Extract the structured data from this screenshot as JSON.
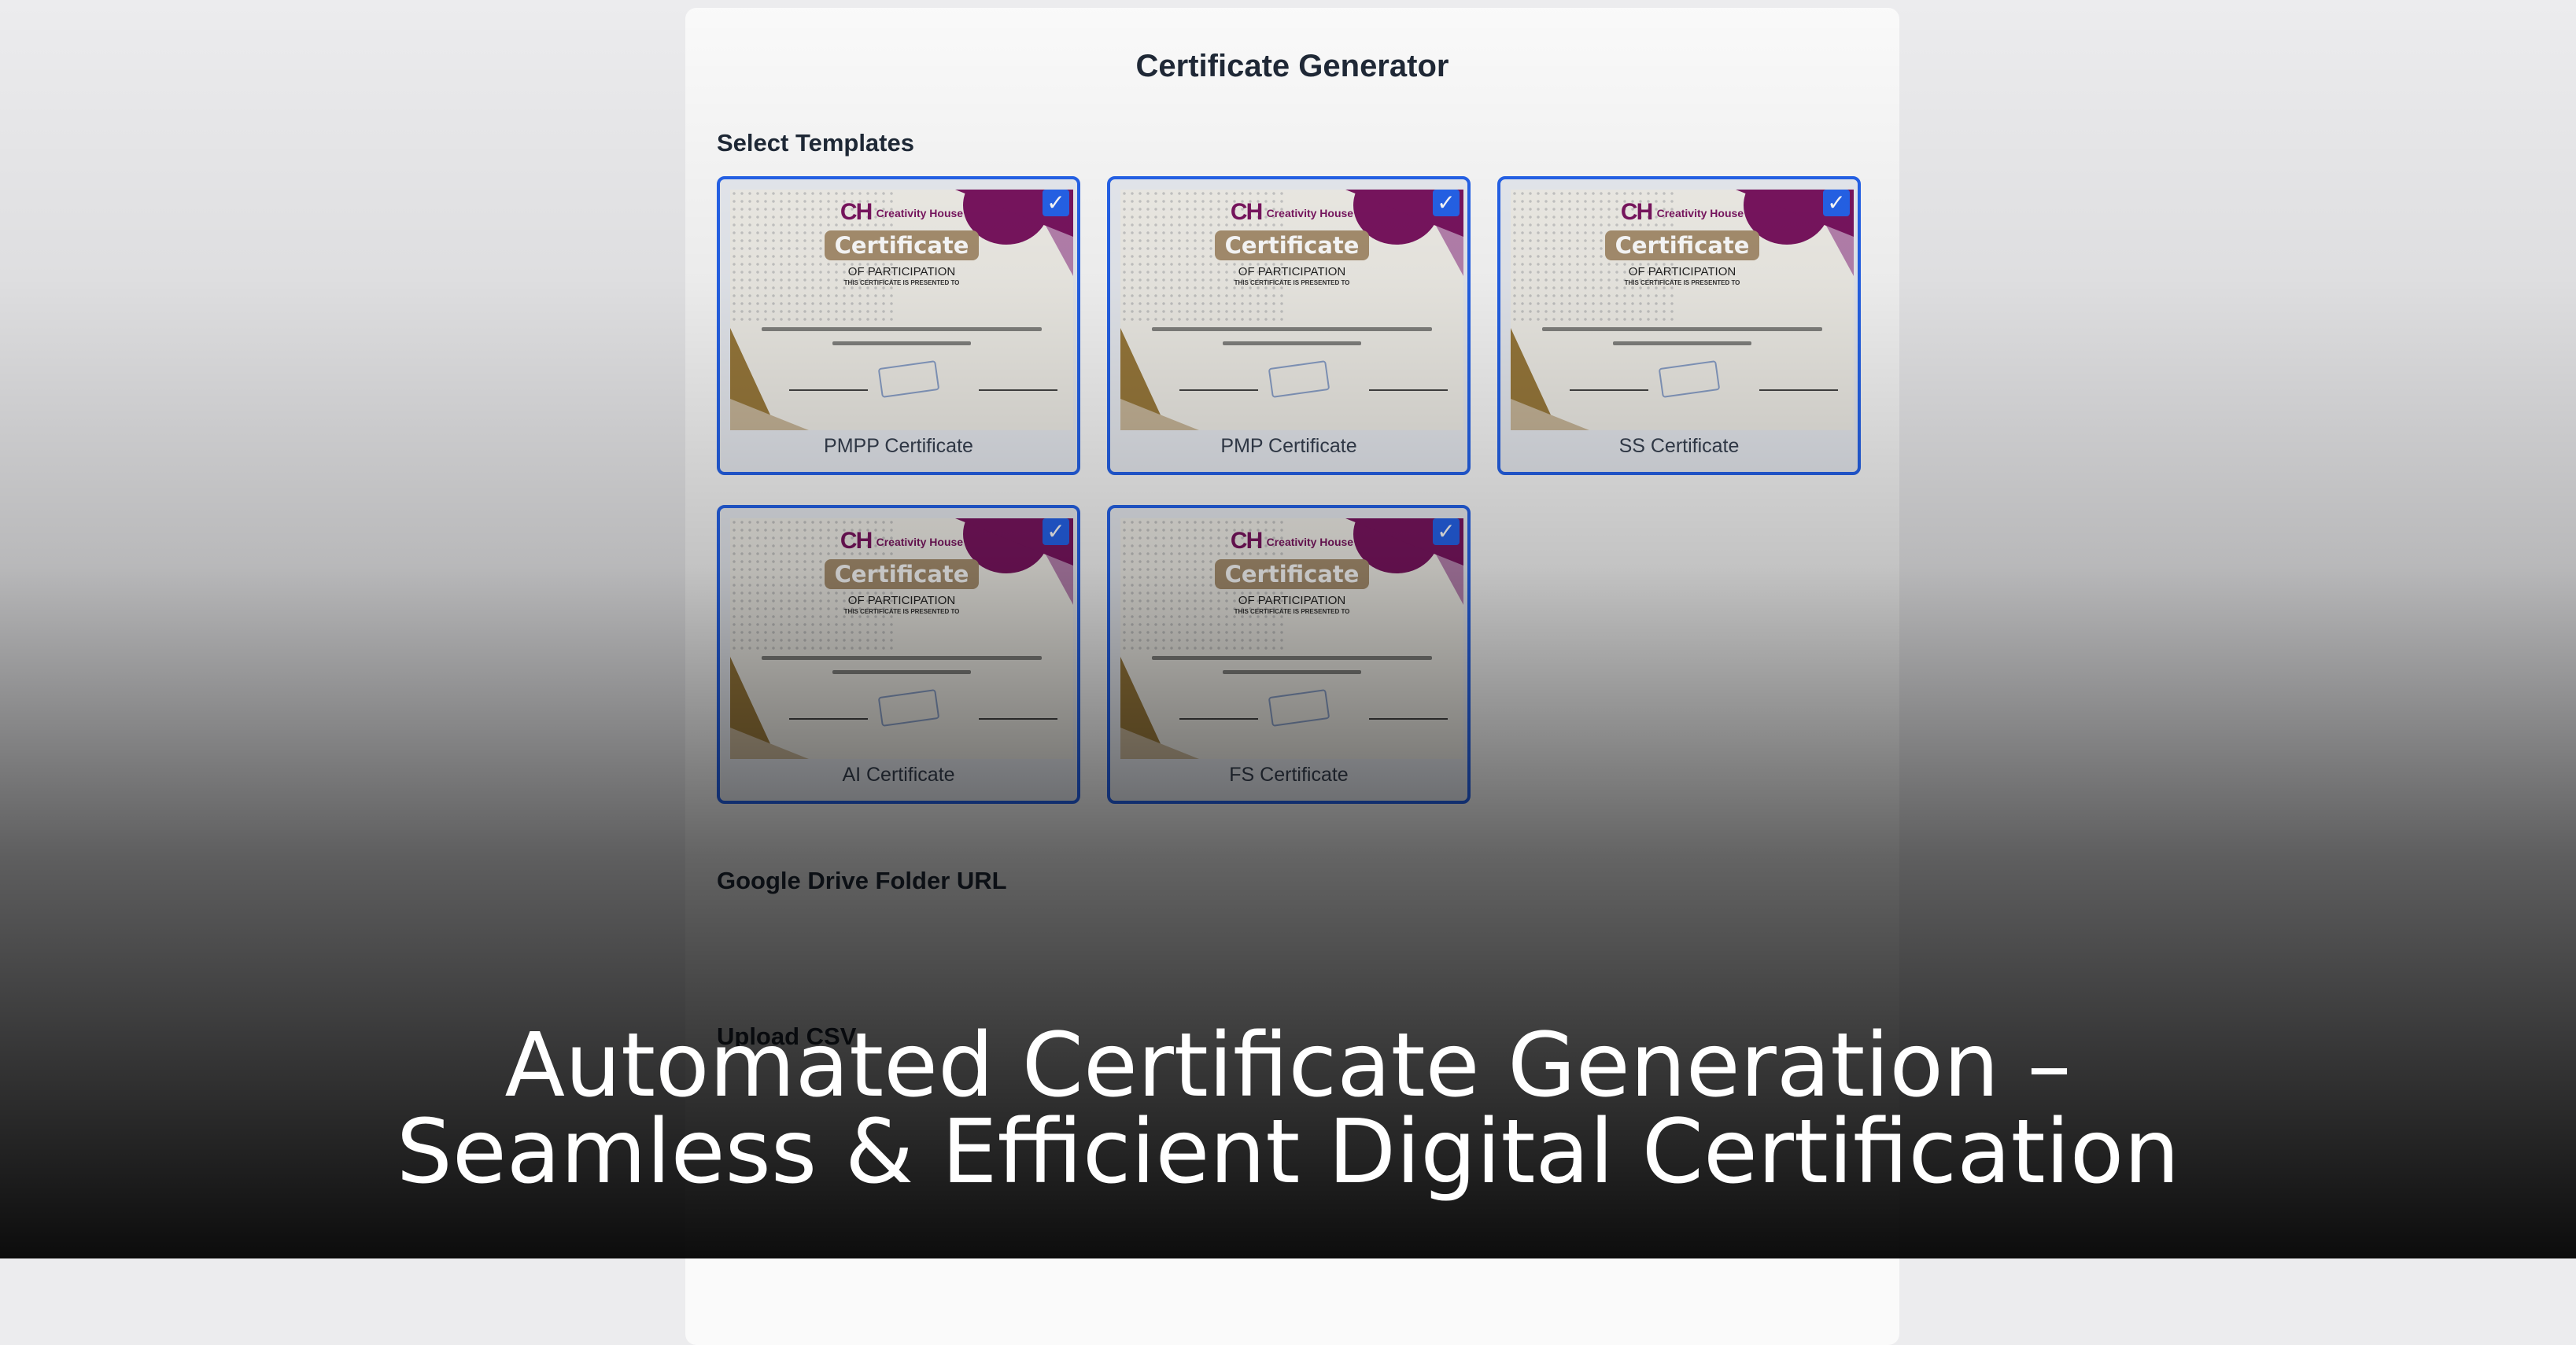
{
  "app": {
    "title": "Certificate Generator"
  },
  "templates": {
    "label": "Select Templates",
    "items": [
      {
        "label": "PMPP Certificate",
        "checked": true
      },
      {
        "label": "PMP Certificate",
        "checked": true
      },
      {
        "label": "SS Certificate",
        "checked": true
      },
      {
        "label": "AI Certificate",
        "checked": true
      },
      {
        "label": "FS Certificate",
        "checked": true
      }
    ],
    "thumbnail": {
      "logo": "CH",
      "logo_text": "Creativity House",
      "heading": "Certificate",
      "subheading": "OF PARTICIPATION",
      "presented": "THIS CERTIFICATE IS PRESENTED TO"
    }
  },
  "drive": {
    "label": "Google Drive Folder URL"
  },
  "csv": {
    "label": "Upload CSV"
  },
  "caption": {
    "line1": "Automated Certificate Generation –",
    "line2": "Seamless & Efficient Digital Certification"
  },
  "colors": {
    "accent": "#2563eb",
    "brand": "#7a1560"
  }
}
